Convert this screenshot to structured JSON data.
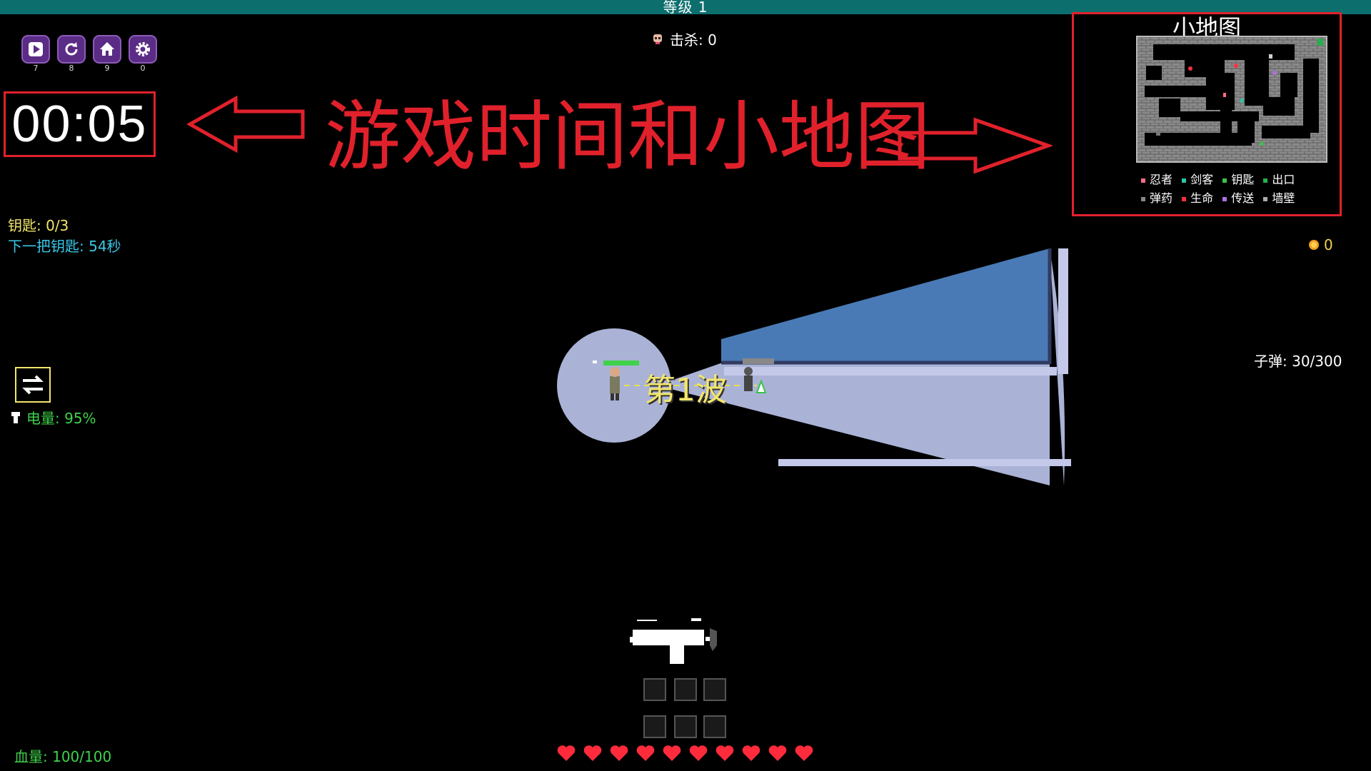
{
  "topbar": {
    "level_label": "等级 1"
  },
  "kills": {
    "label": "击杀: 0"
  },
  "controls": [
    {
      "icon": "play-icon",
      "key": "7"
    },
    {
      "icon": "restart-icon",
      "key": "8"
    },
    {
      "icon": "home-icon",
      "key": "9"
    },
    {
      "icon": "gear-icon",
      "key": "0"
    }
  ],
  "timer": {
    "value": "00:05"
  },
  "annotation": {
    "text": "游戏时间和小地图",
    "color": "#e0212b"
  },
  "keys": {
    "count_label": "钥匙: 0/3",
    "next_label": "下一把钥匙: 54秒"
  },
  "power": {
    "label": "电量: 95%"
  },
  "coins": {
    "value": "0"
  },
  "ammo": {
    "label": "子弹: 30/300"
  },
  "wave": {
    "label": "第1波"
  },
  "health": {
    "label": "血量: 100/100",
    "hearts": 10,
    "player_bar_fraction": 1.0
  },
  "minimap": {
    "title": "小地图",
    "legend_row1": [
      {
        "icon": "ninja-icon",
        "label": "忍者",
        "color": "#ff6a8a"
      },
      {
        "icon": "swordsman-icon",
        "label": "剑客",
        "color": "#29c5a8"
      },
      {
        "icon": "key-icon",
        "label": "钥匙",
        "color": "#39c24a"
      },
      {
        "icon": "exit-icon",
        "label": "出口",
        "color": "#24b04a"
      }
    ],
    "legend_row2": [
      {
        "icon": "ammo-icon",
        "label": "弹药",
        "color": "#888888"
      },
      {
        "icon": "life-icon",
        "label": "生命",
        "color": "#ff3040"
      },
      {
        "icon": "portal-icon",
        "label": "传送",
        "color": "#b070e0"
      },
      {
        "icon": "wall-icon",
        "label": "墙壁",
        "color": "#aaaaaa"
      }
    ]
  },
  "colors": {
    "accent_red": "#e0212b",
    "topbar": "#0d6e6e",
    "key_yellow": "#f3e66b",
    "next_key_cyan": "#39c8e8",
    "power_green": "#3fd24a",
    "health_green": "#3fd24a",
    "water": "#4a7ab5",
    "light": "#aab3d6"
  }
}
